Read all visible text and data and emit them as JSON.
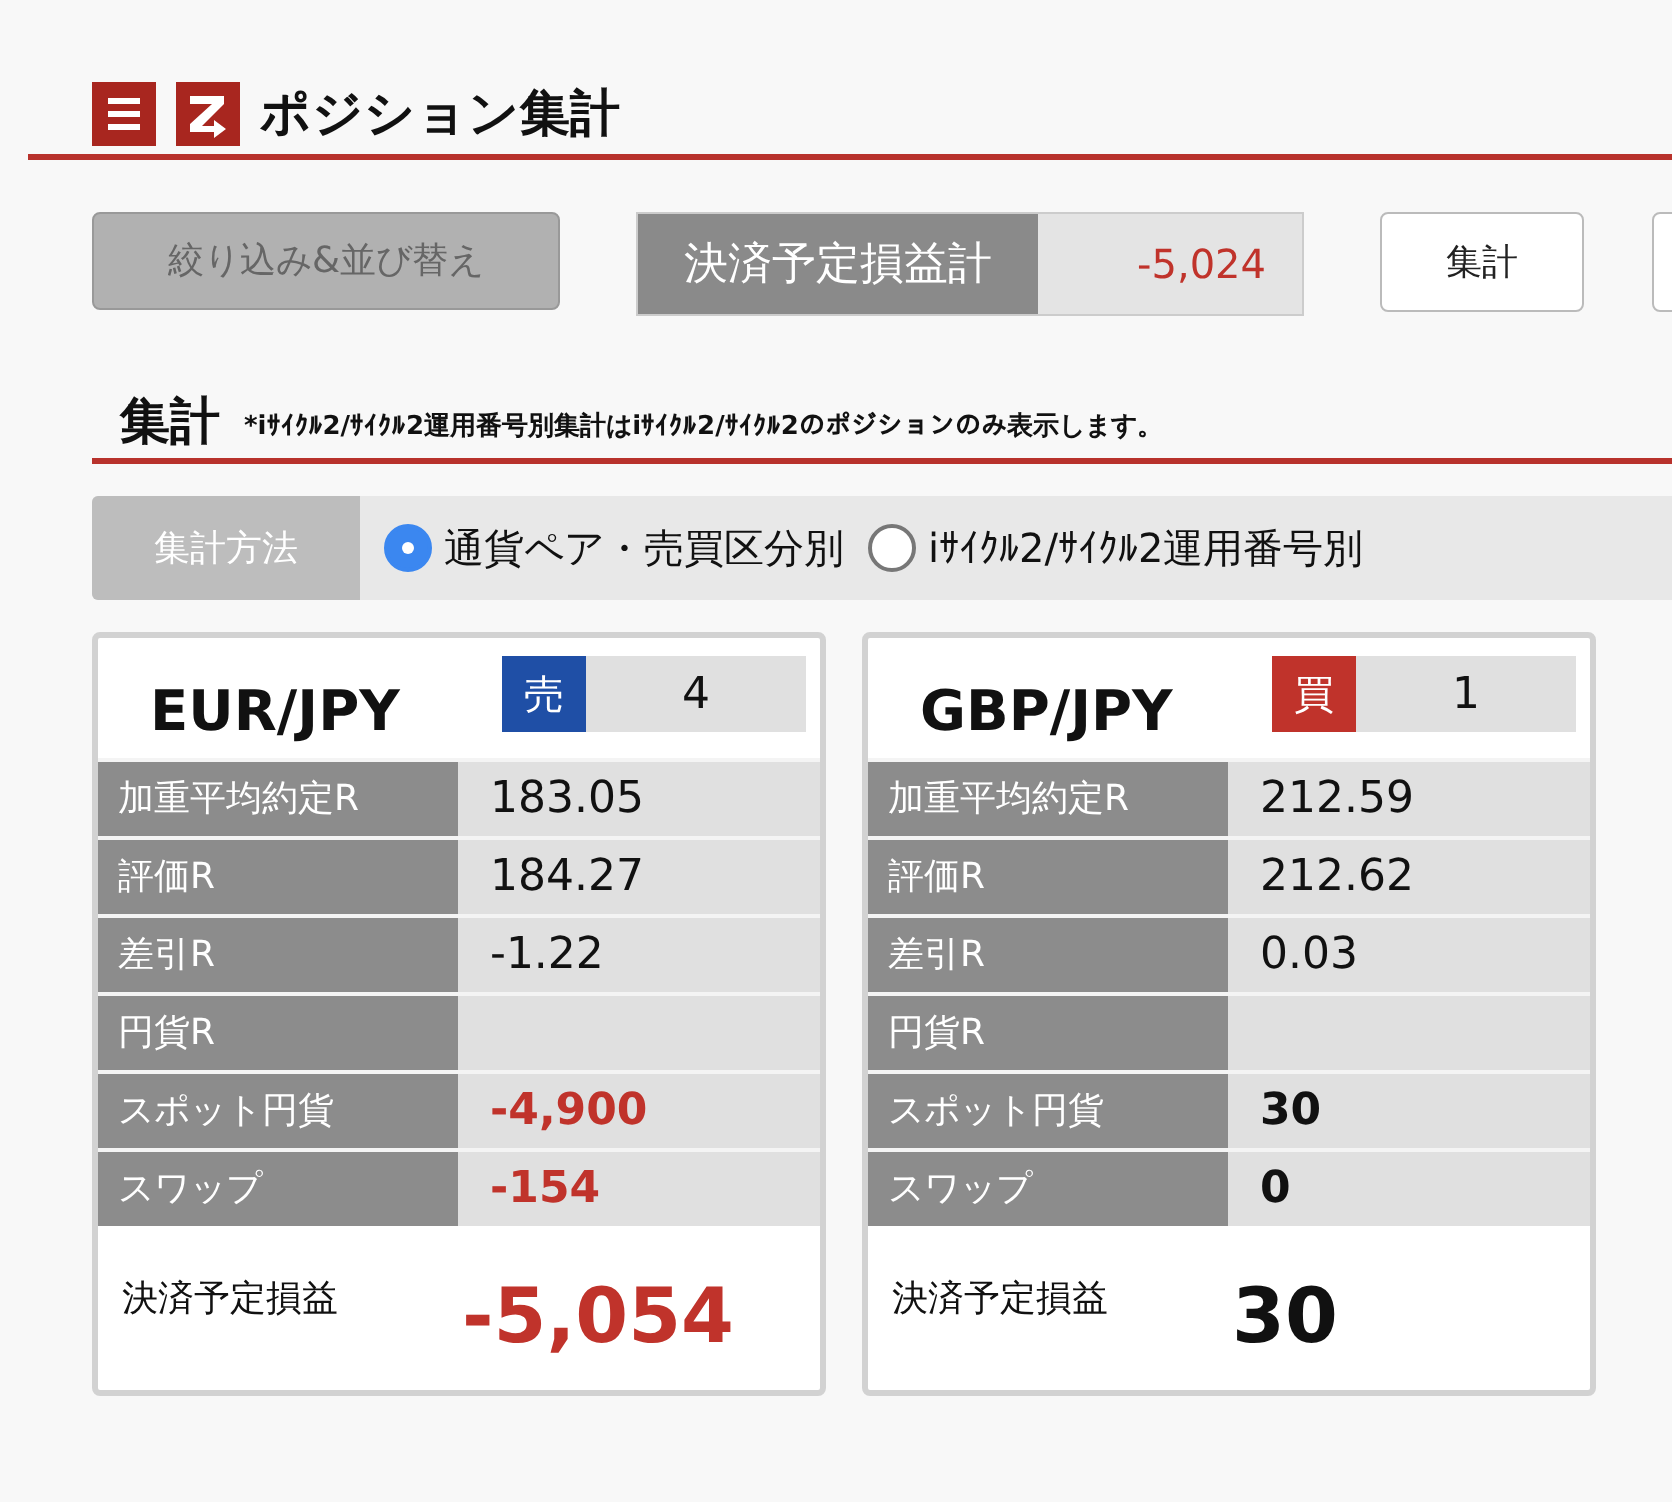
{
  "header": {
    "title": "ポジション集計"
  },
  "toolbar": {
    "filter_button": "絞り込み&並び替え",
    "total": {
      "label": "決済予定損益計",
      "value": "-5,024",
      "negative": true
    },
    "aggregate_button": "集計"
  },
  "section": {
    "title": "集計",
    "note": "*iｻｲｸﾙ2/ｻｲｸﾙ2運用番号別集計はiｻｲｸﾙ2/ｻｲｸﾙ2のポジションのみ表示します。"
  },
  "method": {
    "label": "集計方法",
    "options": [
      {
        "label": "通貨ペア・売買区分別",
        "selected": true
      },
      {
        "label": "iｻｲｸﾙ2/ｻｲｸﾙ2運用番号別",
        "selected": false
      }
    ]
  },
  "cards": [
    {
      "pair": "EUR/JPY",
      "side": {
        "kind": "sell",
        "label": "売"
      },
      "count": "4",
      "rows": [
        {
          "kind": "rate",
          "label": "加重平均約定R",
          "value": "183.05"
        },
        {
          "kind": "rate",
          "label": "評価R",
          "value": "184.27"
        },
        {
          "kind": "rate",
          "label": "差引R",
          "value": "-1.22"
        },
        {
          "kind": "rate",
          "label": "円貨R"
        },
        {
          "kind": "amount",
          "label": "スポット円貨",
          "value": "-4,900",
          "negative": true
        },
        {
          "kind": "amount",
          "label": "スワップ",
          "value": "-154",
          "negative": true
        }
      ],
      "total": {
        "label": "決済予定損益",
        "value": "-5,054",
        "negative": true
      }
    },
    {
      "pair": "GBP/JPY",
      "side": {
        "kind": "buy",
        "label": "買"
      },
      "count": "1",
      "rows": [
        {
          "kind": "rate",
          "label": "加重平均約定R",
          "value": "212.59"
        },
        {
          "kind": "rate",
          "label": "評価R",
          "value": "212.62"
        },
        {
          "kind": "rate",
          "label": "差引R",
          "value": "0.03"
        },
        {
          "kind": "rate",
          "label": "円貨R"
        },
        {
          "kind": "amount",
          "label": "スポット円貨",
          "value": "30",
          "negative": false
        },
        {
          "kind": "amount",
          "label": "スワップ",
          "value": "0",
          "negative": false
        }
      ],
      "total": {
        "label": "決済予定損益",
        "value": "30",
        "negative": false
      }
    }
  ]
}
